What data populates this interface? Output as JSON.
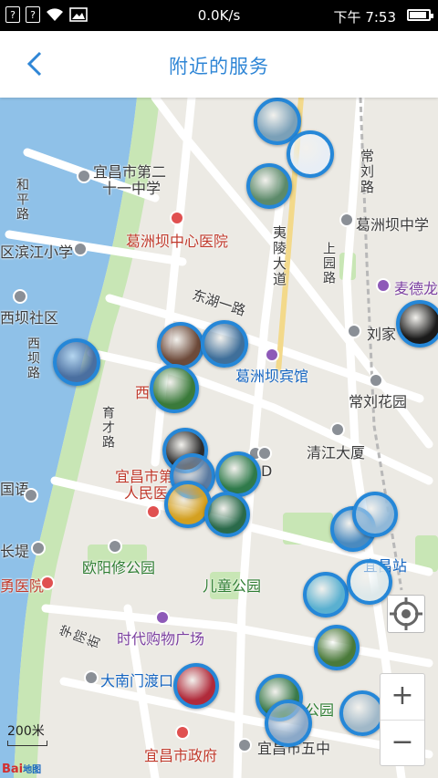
{
  "status_bar": {
    "speed": "0.0K/s",
    "time": "下午 7:53",
    "left_box_1": "?",
    "left_box_2": "?",
    "battery_level": 0.9
  },
  "header": {
    "title": "附近的服务"
  },
  "map": {
    "labels": {
      "yichang_no21": "宜昌市第二",
      "yichang_no21_line2": "十一中学",
      "heping_road": "和平路",
      "binjiang_school": "区滨江小学",
      "gezhouba_hospital": "葛洲坝中心医院",
      "yiling_avenue": "夷陵大道",
      "changliu_road": "常刘路",
      "gezhouba_middle": "葛洲坝中学",
      "dongba_community": "西坝社区",
      "xiba_road": "西坝路",
      "donghu_road": "东湖一路",
      "shangyu_road": "上园路",
      "mcdonalds": "麦德龙",
      "liujia": "刘家",
      "gezhouba_hotel": "葛洲坝宾馆",
      "changliu_garden": "常刘花园",
      "yucai_road": "育才路",
      "xi": "西",
      "qingjiang_building": "清江大厦",
      "yichang_hospital_1": "宜昌市第",
      "yichang_hospital_2": "人民医",
      "d_label": "D",
      "language_school": "国语",
      "changjia": "长堤",
      "ouyangxiu_park": "欧阳修公园",
      "yichang_station": "宜昌站",
      "hospital_left": "勇医院",
      "children_park": "儿童公园",
      "xueyuan_street": "学院街",
      "shidai_mall": "时代购物广场",
      "danan_ferry": "大南门渡口",
      "park": "公园",
      "yichang_gov": "宜昌市政府",
      "yichang_no5": "宜昌市五中",
      "scale": "200米"
    },
    "markers": [
      {
        "name": "shop-a",
        "color": "#7aa0b8"
      },
      {
        "name": "wedding-dress",
        "color": "#e8eef5"
      },
      {
        "name": "beauty-shop",
        "color": "#5c8a6a"
      },
      {
        "name": "storefront-1",
        "color": "#6d4a3a"
      },
      {
        "name": "storefront-2",
        "color": "#3f6f9a"
      },
      {
        "name": "shop-left",
        "color": "#4a6fa0"
      },
      {
        "name": "rose",
        "color": "#3a7a3a"
      },
      {
        "name": "shop-cluster-1",
        "color": "#2c2c2c"
      },
      {
        "name": "shop-cluster-2",
        "color": "#5a7aa0"
      },
      {
        "name": "pharmacy",
        "color": "#2f7a4a"
      },
      {
        "name": "flower",
        "color": "#d4a020"
      },
      {
        "name": "tiffany",
        "color": "#2a6a4a"
      },
      {
        "name": "shop-right-1",
        "color": "#4a8abf"
      },
      {
        "name": "shop-right-2",
        "color": "#90b8d8"
      },
      {
        "name": "water",
        "color": "#5ab0d0"
      },
      {
        "name": "shop-white",
        "color": "#dde8ea"
      },
      {
        "name": "shop-green",
        "color": "#4a7a3a"
      },
      {
        "name": "red-gift",
        "color": "#b02a3a"
      },
      {
        "name": "shop-bottom-1",
        "color": "#3a7a4a"
      },
      {
        "name": "shop-bottom-2",
        "color": "#8aa8c8"
      },
      {
        "name": "shop-right-bottom",
        "color": "#a0b8c8"
      },
      {
        "name": "dark-sign",
        "color": "#1a1a1a"
      }
    ],
    "logo": "Bai",
    "logo_sub": "地图"
  },
  "colors": {
    "accent": "#2f86d6",
    "marker_border": "#2587d8",
    "river": "#8fc1e8",
    "green": "#c8e6b5"
  }
}
